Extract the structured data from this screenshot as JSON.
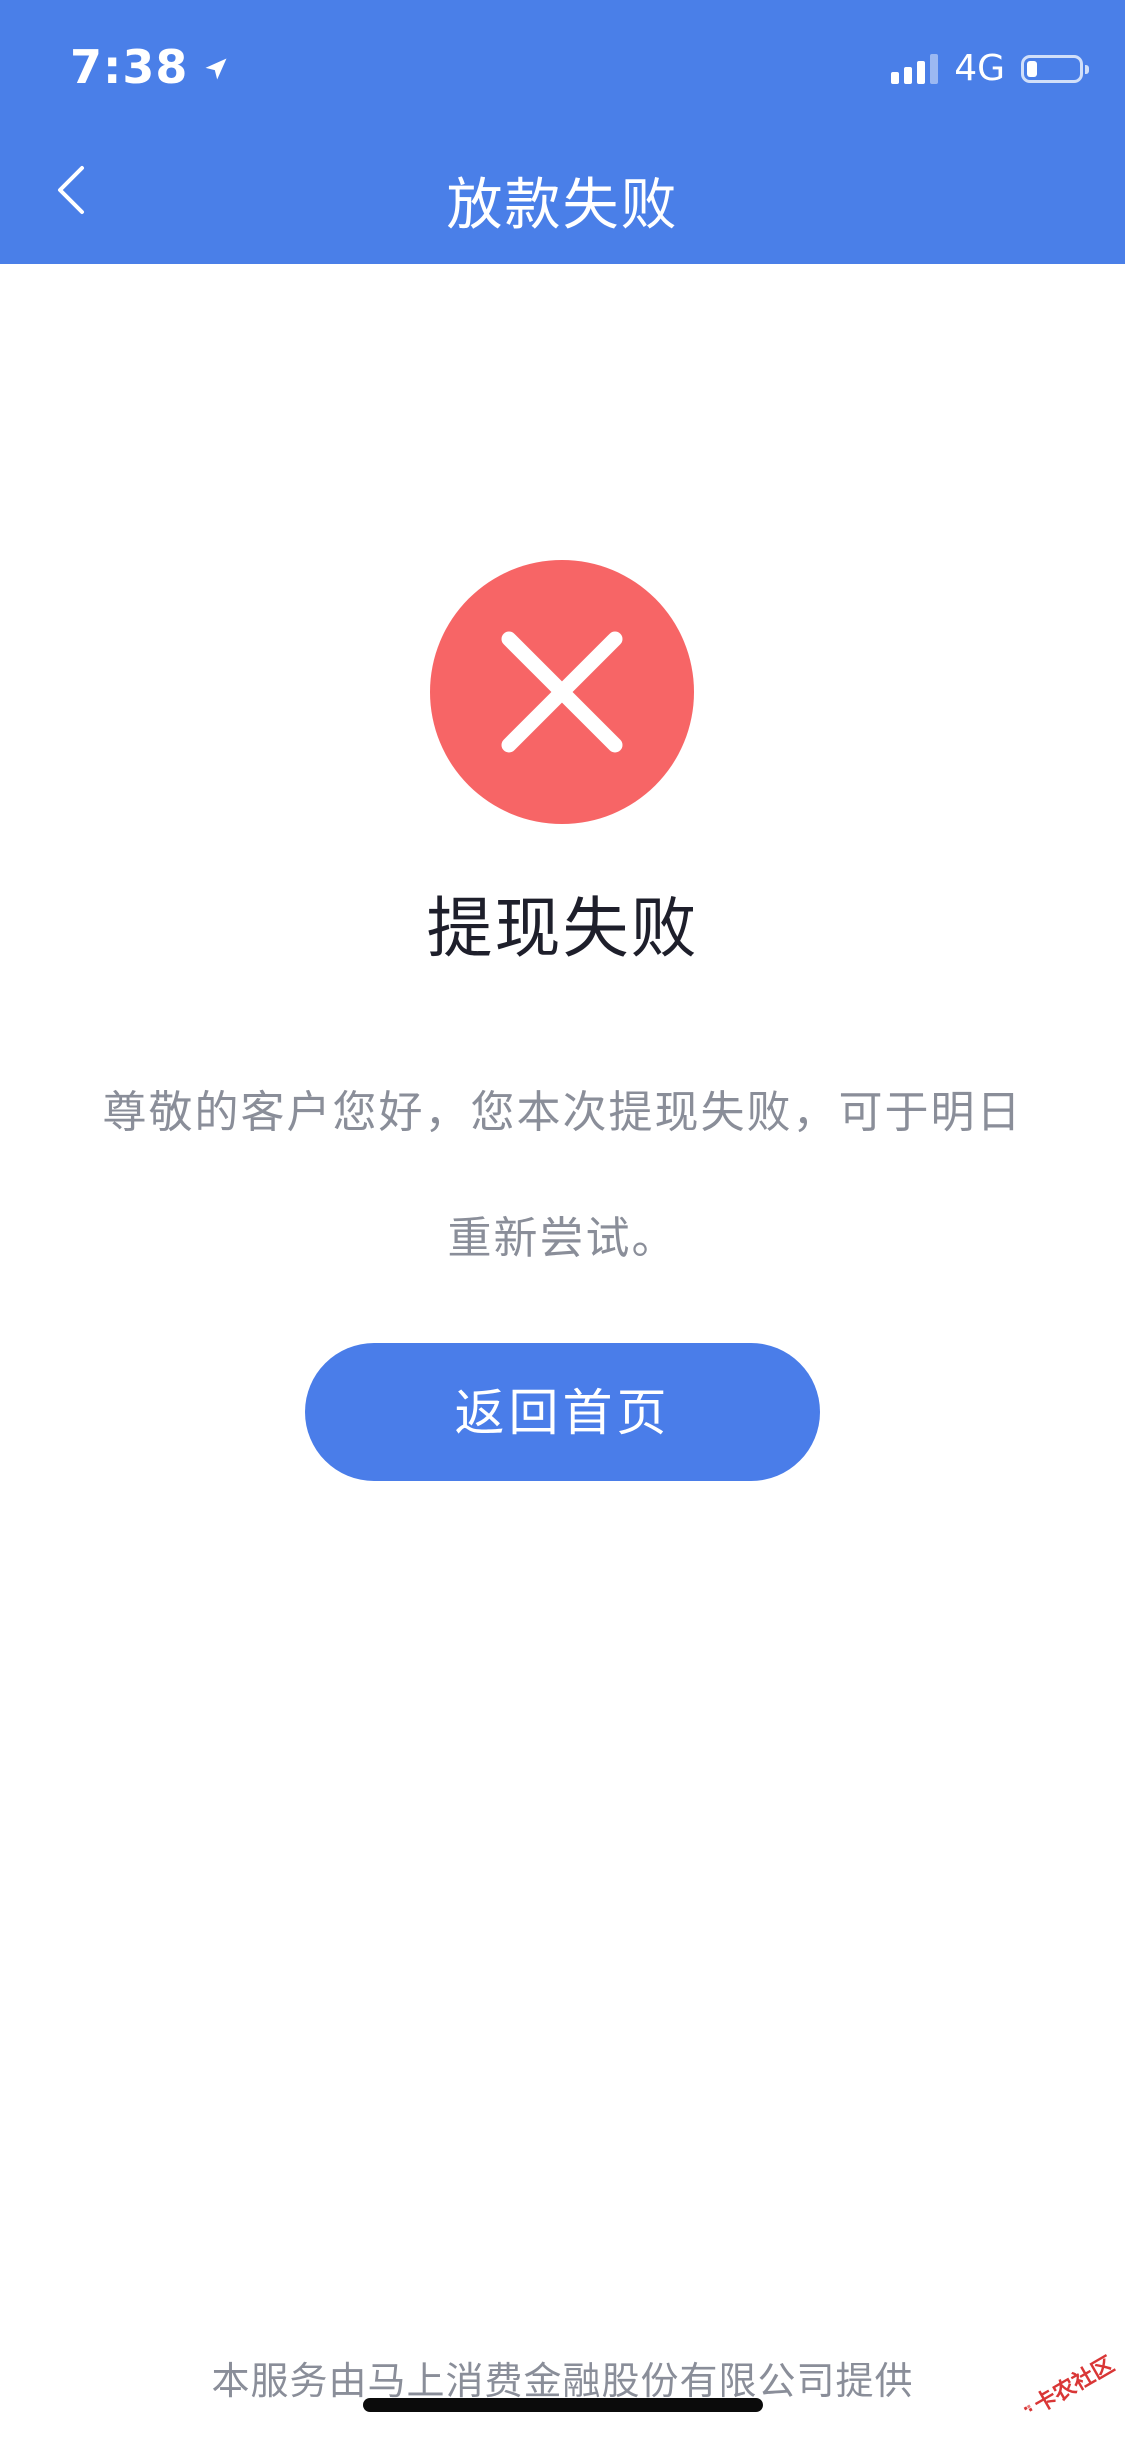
{
  "status_bar": {
    "time": "7:38",
    "network": "4G",
    "battery_level": 0.2
  },
  "nav": {
    "title": "放款失败"
  },
  "result": {
    "title": "提现失败",
    "message": "尊敬的客户您好，您本次提现失败，可于明日重新尝试。"
  },
  "actions": {
    "home_button_label": "返回首页"
  },
  "footer": {
    "provider_text": "本服务由马上消费金融股份有限公司提供"
  },
  "watermark": {
    "text": "卡农社区"
  },
  "colors": {
    "header_blue": "#4a7fe8",
    "error_red": "#f76566",
    "button_blue": "#4a7de9",
    "body_text_gray": "#8a8e99"
  }
}
